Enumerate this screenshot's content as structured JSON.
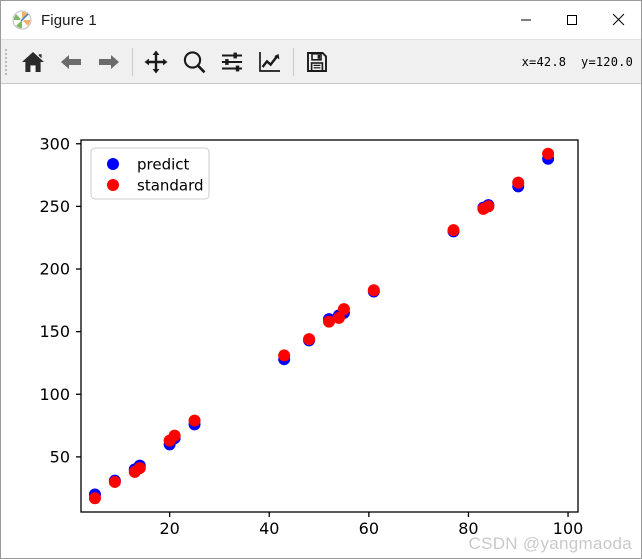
{
  "window": {
    "title": "Figure 1",
    "icon": "matplotlib-logo-icon",
    "controls": {
      "minimize": "minimize-icon",
      "maximize": "maximize-icon",
      "close": "close-icon"
    }
  },
  "toolbar": {
    "buttons": [
      {
        "name": "home-button",
        "tooltip": "Reset original view"
      },
      {
        "name": "back-button",
        "tooltip": "Back to previous view"
      },
      {
        "name": "forward-button",
        "tooltip": "Forward to next view"
      },
      {
        "name": "pan-button",
        "tooltip": "Pan axes with left mouse, zoom with right"
      },
      {
        "name": "zoom-button",
        "tooltip": "Zoom to rectangle"
      },
      {
        "name": "subplots-button",
        "tooltip": "Configure subplots"
      },
      {
        "name": "customize-button",
        "tooltip": "Edit axis, curve and image parameters"
      },
      {
        "name": "save-button",
        "tooltip": "Save the figure"
      }
    ],
    "coordinates": "x=42.8  y=120.0"
  },
  "watermark": "CSDN @yangmaoda",
  "chart_data": {
    "type": "scatter",
    "title": "",
    "xlabel": "",
    "ylabel": "",
    "xlim": [
      2.2,
      102.0
    ],
    "ylim": [
      6.0,
      303.0
    ],
    "xticks": [
      20,
      40,
      60,
      80,
      100
    ],
    "yticks": [
      50,
      100,
      150,
      200,
      250,
      300
    ],
    "grid": false,
    "legend_position": "upper left",
    "colors": {
      "predict": "#0000ff",
      "standard": "#ff0000",
      "axes_frame": "#000000",
      "figure_background": "#ffffff"
    },
    "series": [
      {
        "name": "predict",
        "marker": "o",
        "color": "#0000ff",
        "points": [
          [
            5,
            20
          ],
          [
            9,
            31
          ],
          [
            13,
            40
          ],
          [
            14,
            43
          ],
          [
            20,
            60
          ],
          [
            21,
            65
          ],
          [
            25,
            76
          ],
          [
            43,
            128
          ],
          [
            48,
            143
          ],
          [
            52,
            160
          ],
          [
            54,
            163
          ],
          [
            55,
            165
          ],
          [
            61,
            182
          ],
          [
            77,
            230
          ],
          [
            83,
            249
          ],
          [
            84,
            251
          ],
          [
            90,
            266
          ],
          [
            96,
            288
          ]
        ]
      },
      {
        "name": "standard",
        "marker": "o",
        "color": "#ff0000",
        "points": [
          [
            5,
            17
          ],
          [
            9,
            30
          ],
          [
            13,
            38
          ],
          [
            14,
            41
          ],
          [
            20,
            63
          ],
          [
            21,
            67
          ],
          [
            25,
            79
          ],
          [
            43,
            131
          ],
          [
            48,
            144
          ],
          [
            52,
            158
          ],
          [
            54,
            161
          ],
          [
            55,
            168
          ],
          [
            61,
            183
          ],
          [
            77,
            231
          ],
          [
            83,
            248
          ],
          [
            84,
            250
          ],
          [
            90,
            269
          ],
          [
            96,
            292
          ]
        ]
      }
    ]
  }
}
